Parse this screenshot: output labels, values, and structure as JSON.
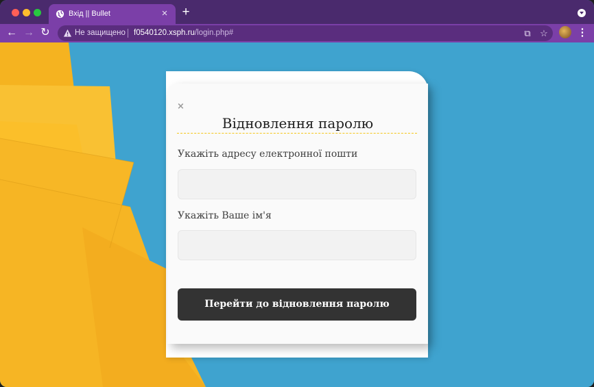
{
  "browser": {
    "tab": {
      "title": "Вхід || Bullet"
    },
    "toolbar": {
      "security_label": "Не защищено",
      "url_host": "f0540120.xsph.ru",
      "url_path": "/login.php#"
    },
    "colors": {
      "tabstrip": "#4a2a6d",
      "toolbar": "#7b3fa8",
      "page_background": "#3fa3cf",
      "paper": "#f7b928"
    },
    "icons": [
      "globe-icon",
      "close-icon",
      "plus-icon",
      "dropdown-icon",
      "back-icon",
      "forward-icon",
      "reload-icon",
      "warning-icon",
      "translate-icon",
      "star-icon",
      "avatar",
      "kebab-menu-icon"
    ]
  },
  "modal": {
    "close_glyph": "×",
    "title": "Відновлення паролю",
    "email_label": "Укажіть адресу електронної пошти",
    "name_label": "Укажіть Ваше ім'я",
    "submit_label": "Перейти до відновлення паролю",
    "colors": {
      "accent_underline": "#f5c518",
      "button": "#333333"
    }
  }
}
